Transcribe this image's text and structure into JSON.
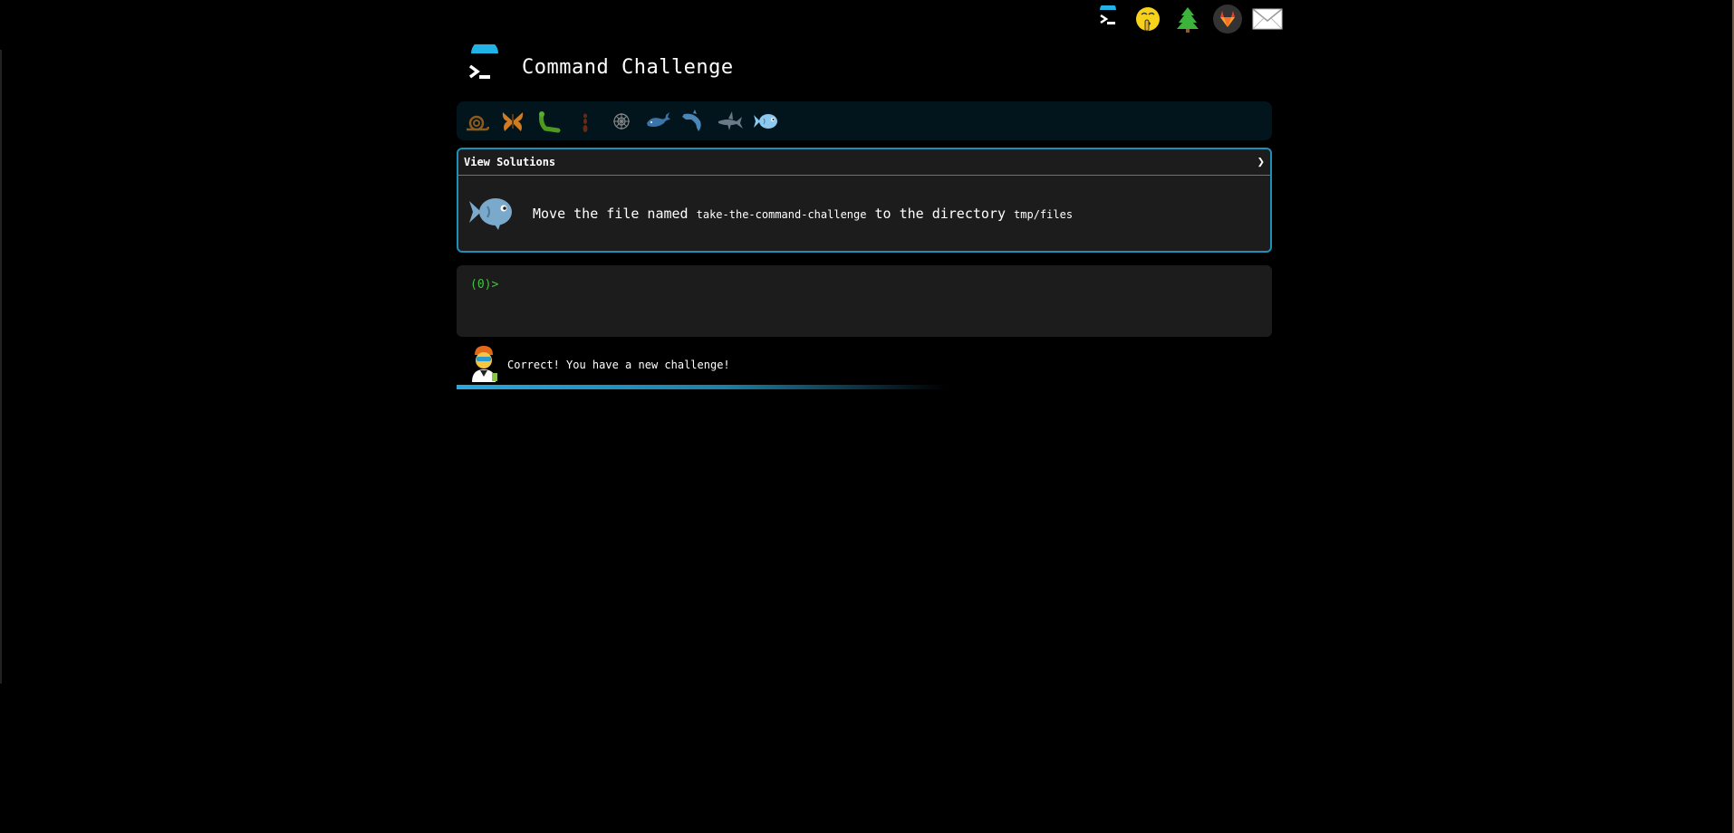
{
  "title": "Command Challenge",
  "nav": {
    "icons": [
      "terminal-icon",
      "shushing-face-icon",
      "tree-icon",
      "gitlab-icon",
      "mail-icon"
    ]
  },
  "levels": [
    "snail-icon",
    "butterfly-icon",
    "caterpillar-icon",
    "ant-icon",
    "spider-web-icon",
    "whale-icon",
    "dolphin-icon",
    "shark-icon",
    "fish-icon"
  ],
  "solutions": {
    "label": "View Solutions",
    "chevron": "❯"
  },
  "challenge": {
    "prefix": "Move the file named",
    "filename": "take-the-command-challenge",
    "middle": "to the directory",
    "directory": "tmp/files"
  },
  "terminal": {
    "prompt": "(0)>"
  },
  "status": {
    "message": "Correct! You have a new challenge!"
  },
  "colors": {
    "accent": "#1d8fb8",
    "prompt": "#3ec43e",
    "background": "#000000",
    "panel": "#1c1c1c",
    "level_bar": "#02141c"
  }
}
